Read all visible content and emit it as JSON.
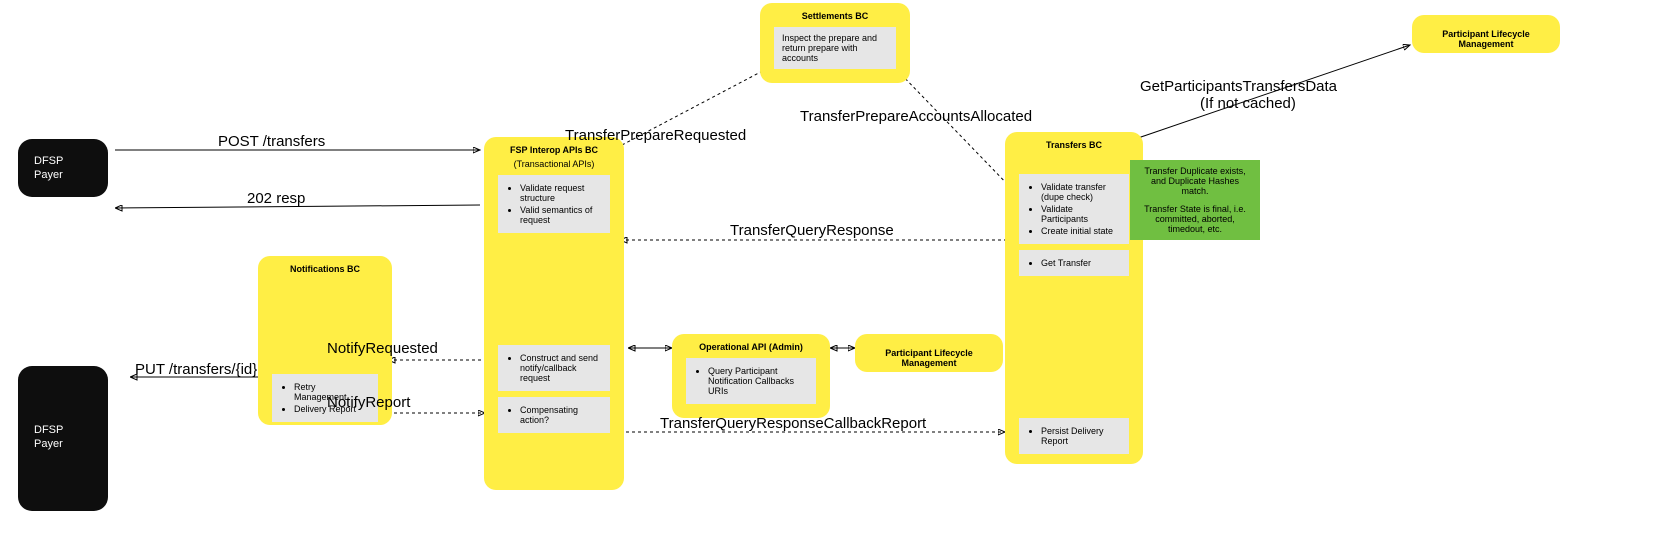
{
  "actors": {
    "top": {
      "line1": "DFSP",
      "line2": "Payer"
    },
    "bottom": {
      "line1": "DFSP",
      "line2": "Payer"
    }
  },
  "settlements": {
    "title": "Settlements BC",
    "task1": "Inspect the prepare and return prepare with accounts"
  },
  "fsp": {
    "title": "FSP Interop APIs BC",
    "subtitle": "(Transactional APIs)",
    "t1a": "Validate request structure",
    "t1b": "Valid semantics of request",
    "t2": "Construct and send notify/callback request",
    "t3": "Compensating action?"
  },
  "transfers": {
    "title": "Transfers BC",
    "t1a": "Validate transfer (dupe check)",
    "t1b": "Validate Participants",
    "t1c": "Create initial state",
    "t2": "Get Transfer",
    "t3": "Persist Delivery Report"
  },
  "notifications": {
    "title": "Notifications BC",
    "t1": "Retry Management",
    "t2": "Delivery Report"
  },
  "opapi": {
    "title": "Operational API (Admin)",
    "t1": "Query Participant Notification Callbacks URIs"
  },
  "plm_mid": {
    "title": "Participant Lifecycle Management"
  },
  "plm_top": {
    "title": "Participant Lifecycle Management"
  },
  "labels": {
    "post": "POST /transfers",
    "resp": "202 resp",
    "put": "PUT /transfers/{id}",
    "notifyReq": "NotifyRequested",
    "notifyRep": "NotifyReport",
    "prepReq": "TransferPrepareRequested",
    "prepAcc": "TransferPrepareAccountsAllocated",
    "queryResp": "TransferQueryResponse",
    "callbackReport": "TransferQueryResponseCallbackReport",
    "getData": "GetParticipantsTransfersData",
    "getDataSub": "(If not cached)"
  },
  "green": {
    "l1": "Transfer Duplicate exists, and Duplicate Hashes match.",
    "l2": "Transfer State is final, i.e. committed, aborted, timedout, etc."
  }
}
